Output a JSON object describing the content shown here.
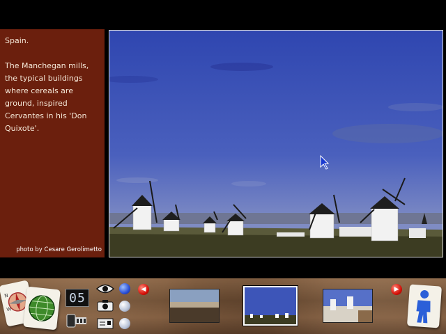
{
  "caption": {
    "title": "Spain.",
    "body": "The Manchegan mills,\nthe typical buildings\nwhere cereals are\nground, inspired\nCervantes in his 'Don\nQuixote'.",
    "credit": "photo by Cesare Gerolimetto"
  },
  "toolbar": {
    "counter": "05"
  },
  "colors": {
    "caption_bg": "#6b1f0d",
    "sky": "#3d54b6",
    "toolbar": "#7f5b3e"
  }
}
